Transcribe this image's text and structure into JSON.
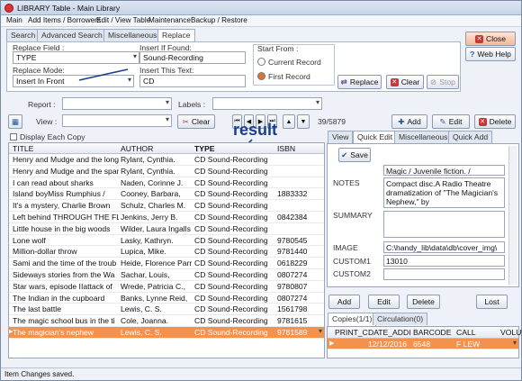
{
  "window": {
    "title": "LIBRARY Table - Main Library"
  },
  "menu": [
    "Main",
    "Add Items / Borrowers",
    "Edit / View Table",
    "Maintenance",
    "Backup / Restore"
  ],
  "tabs": [
    "Search",
    "Advanced Search",
    "Miscellaneous",
    "Replace"
  ],
  "replace": {
    "field_label": "Replace Field :",
    "field_value": "TYPE",
    "if_found_label": "Insert If Found:",
    "if_found_value": "Sound-Recording",
    "mode_label": "Replace Mode:",
    "mode_value": "Insert In Front",
    "text_label": "Insert This Text:",
    "text_value": "CD",
    "start_from_label": "Start From :",
    "radio_current": "Current Record",
    "radio_first": "First Record",
    "btn_replace": "Replace",
    "btn_clear": "Clear",
    "btn_stop": "Stop"
  },
  "top_buttons": {
    "close": "Close",
    "help": "Web Help"
  },
  "filters": {
    "report_label": "Report :",
    "labels_label": "Labels :",
    "view_label": "View :",
    "clear": "Clear"
  },
  "nav": {
    "count": "39/5879",
    "add": "Add",
    "edit": "Edit",
    "delete": "Delete"
  },
  "display_each_copy": "Display Each Copy",
  "annotation": "result",
  "table": {
    "headers": [
      "TITLE",
      "AUTHOR",
      "TYPE",
      "ISBN"
    ],
    "rows": [
      [
        "Henry and Mudge and the long",
        "Rylant, Cynthia.",
        "CD Sound-Recording",
        ""
      ],
      [
        "Henry and Mudge and the spark",
        "Rylant, Cynthia.",
        "CD Sound-Recording",
        ""
      ],
      [
        "I can read about sharks",
        "Naden, Corinne J.",
        "CD Sound-Recording",
        ""
      ],
      [
        "Island boyMiss Rumphius /",
        "Cooney, Barbara,",
        "CD Sound-Recording",
        "1883332"
      ],
      [
        "It's a mystery, Charlie Brown",
        "Schulz, Charles M.",
        "CD Sound-Recording",
        ""
      ],
      [
        "Left behind THROUGH THE FL",
        "Jenkins, Jerry B.",
        "CD Sound-Recording",
        "0842384"
      ],
      [
        "Little house in the big woods",
        "Wilder, Laura Ingalls",
        "CD Sound-Recording",
        ""
      ],
      [
        "Lone wolf",
        "Lasky, Kathryn.",
        "CD Sound-Recording",
        "9780545"
      ],
      [
        "Million-dollar throw",
        "Lupica, Mike.",
        "CD Sound-Recording",
        "9781440"
      ],
      [
        "Sami and the time of the troub",
        "Heide, Florence Parr",
        "CD Sound-Recording",
        "0618229"
      ],
      [
        "Sideways stories from the Wa",
        "Sachar, Louis,",
        "CD Sound-Recording",
        "0807274"
      ],
      [
        "Star wars, episode IIattack of",
        "Wrede, Patricia C.,",
        "CD Sound-Recording",
        "9780807"
      ],
      [
        "The Indian in the cupboard",
        "Banks, Lynne Reid,",
        "CD Sound-Recording",
        "0807274"
      ],
      [
        "The last battle",
        "Lewis, C. S.",
        "CD Sound-Recording",
        "1561798"
      ],
      [
        "The magic school bus in the ti",
        "Cole, Joanna.",
        "CD Sound-Recording",
        "9781615"
      ],
      [
        "The magician's nephew",
        "Lewis, C. S.",
        "CD Sound-Recording",
        "9781589"
      ]
    ]
  },
  "right_tabs": [
    "View",
    "Quick Edit",
    "Miscellaneous",
    "Quick Add"
  ],
  "quick_edit": {
    "save": "Save",
    "notes_label": "NOTES",
    "notes_top": "Magic / Juvenile fiction. /",
    "notes_value": "Compact disc.A Radio Theatre dramatization of \"The Magician's Nephew,\" by",
    "summary_label": "SUMMARY",
    "image_label": "IMAGE",
    "image_value": "C:\\handy_lib\\data\\db\\cover_img\\",
    "custom1_label": "CUSTOM1",
    "custom1_value": "13010",
    "custom2_label": "CUSTOM2",
    "custom2_value": ""
  },
  "copy_buttons": {
    "add": "Add",
    "edit": "Edit",
    "delete": "Delete",
    "lost": "Lost"
  },
  "copy_tabs": [
    "Copies(1/1)",
    "Circulation(0)"
  ],
  "copies": {
    "headers": [
      "PRINT_C",
      "DATE_ADDI",
      "BARCODE",
      "CALL",
      "VOLU"
    ],
    "row": [
      "",
      "12/12/2016",
      "6548",
      "F LEW",
      ""
    ]
  },
  "status": "Item Changes saved."
}
